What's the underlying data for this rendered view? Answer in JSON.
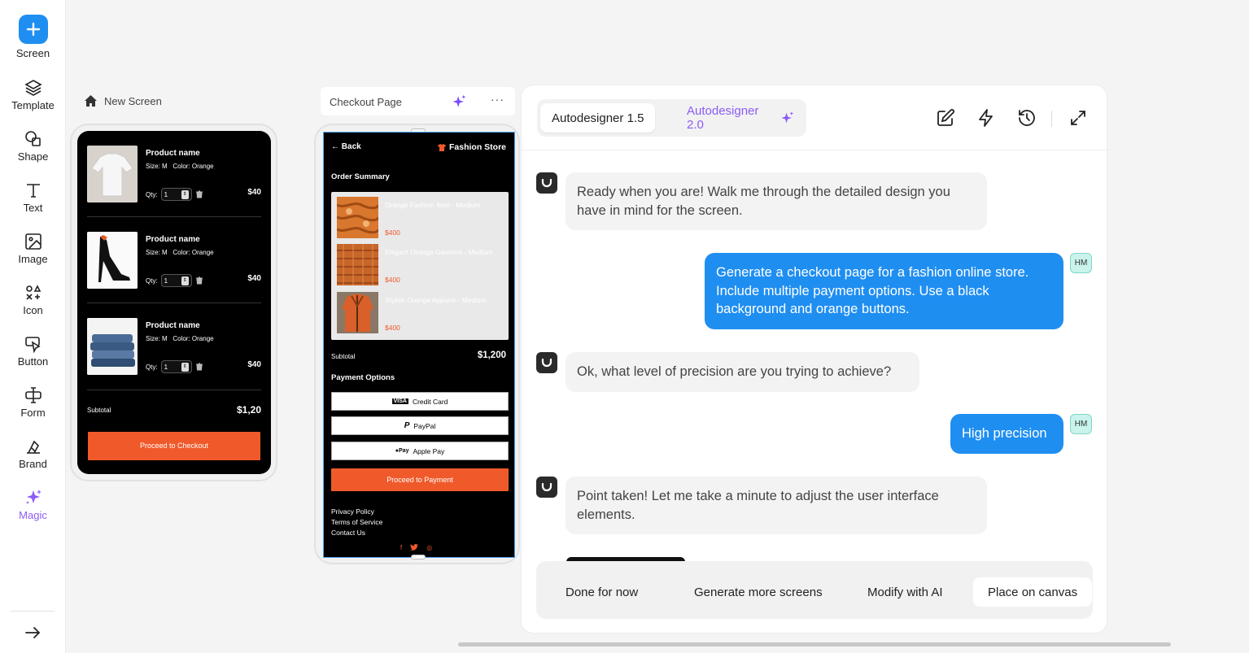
{
  "sidebar": {
    "tools": [
      {
        "id": "screen",
        "label": "Screen",
        "icon": "plus-icon"
      },
      {
        "id": "template",
        "label": "Template",
        "icon": "layers-icon"
      },
      {
        "id": "shape",
        "label": "Shape",
        "icon": "shapes-icon"
      },
      {
        "id": "text",
        "label": "Text",
        "icon": "text-icon"
      },
      {
        "id": "image",
        "label": "Image",
        "icon": "image-icon"
      },
      {
        "id": "icon",
        "label": "Icon",
        "icon": "icons-icon"
      },
      {
        "id": "button",
        "label": "Button",
        "icon": "pointer-icon"
      },
      {
        "id": "form",
        "label": "Form",
        "icon": "form-icon"
      },
      {
        "id": "brand",
        "label": "Brand",
        "icon": "brand-icon"
      },
      {
        "id": "magic",
        "label": "Magic",
        "icon": "sparkle-icon"
      }
    ],
    "accent": "#1f8ef1",
    "magic_color": "#8b5cf6"
  },
  "screen1": {
    "title": "New Screen",
    "items": [
      {
        "name": "Product name",
        "size": "Size: M",
        "color": "Color: Orange",
        "qty_label": "Qty:",
        "qty": "1",
        "price": "$40"
      },
      {
        "name": "Product name",
        "size": "Size: M",
        "color": "Color: Orange",
        "qty_label": "Qty:",
        "qty": "1",
        "price": "$40"
      },
      {
        "name": "Product name",
        "size": "Size: M",
        "color": "Color: Orange",
        "qty_label": "Qty:",
        "qty": "1",
        "price": "$40"
      }
    ],
    "subtotal_label": "Subtotal",
    "subtotal_value": "$1,20",
    "checkout_button": "Proceed to Checkout"
  },
  "screen2": {
    "title": "Checkout Page",
    "back": "Back",
    "store": "Fashion Store",
    "order_heading": "Order Summary",
    "items": [
      {
        "name": "Orange Fashion Item - Medium",
        "price": "$400"
      },
      {
        "name": "Elegant Orange Garment - Medium",
        "price": "$400"
      },
      {
        "name": "Stylish Orange Apparel - Medium",
        "price": "$400"
      }
    ],
    "subtotal_label": "Subtotal",
    "subtotal_value": "$1,200",
    "payment_heading": "Payment Options",
    "payments": [
      {
        "label": "Credit Card",
        "badge": "VISA"
      },
      {
        "label": "PayPal",
        "badge": "P"
      },
      {
        "label": "Apple Pay",
        "badge": "●Pay"
      }
    ],
    "payment_button": "Proceed to Payment",
    "links": [
      "Privacy Policy",
      "Terms of Service",
      "Contact Us"
    ],
    "social": [
      "f",
      "t",
      "◎"
    ],
    "brand_color": "#f05a2b"
  },
  "chat": {
    "models": {
      "v15": "Autodesigner 1.5",
      "v20": "Autodesigner 2.0"
    },
    "messages": [
      {
        "role": "bot",
        "text": "Ready when you are! Walk me through the detailed design you have in mind for the screen."
      },
      {
        "role": "user",
        "text": "Generate a checkout page for a fashion online store. Include multiple payment options. Use a black background and orange buttons.",
        "avatar": "HM"
      },
      {
        "role": "bot",
        "text": "Ok, what level of precision are you trying to achieve?"
      },
      {
        "role": "user",
        "text": "High precision",
        "avatar": "HM"
      },
      {
        "role": "bot",
        "text": "Point taken! Let me take a minute to adjust the user interface elements."
      }
    ],
    "actions": [
      "Done for now",
      "Generate more screens",
      "Modify with AI",
      "Place on canvas"
    ]
  }
}
